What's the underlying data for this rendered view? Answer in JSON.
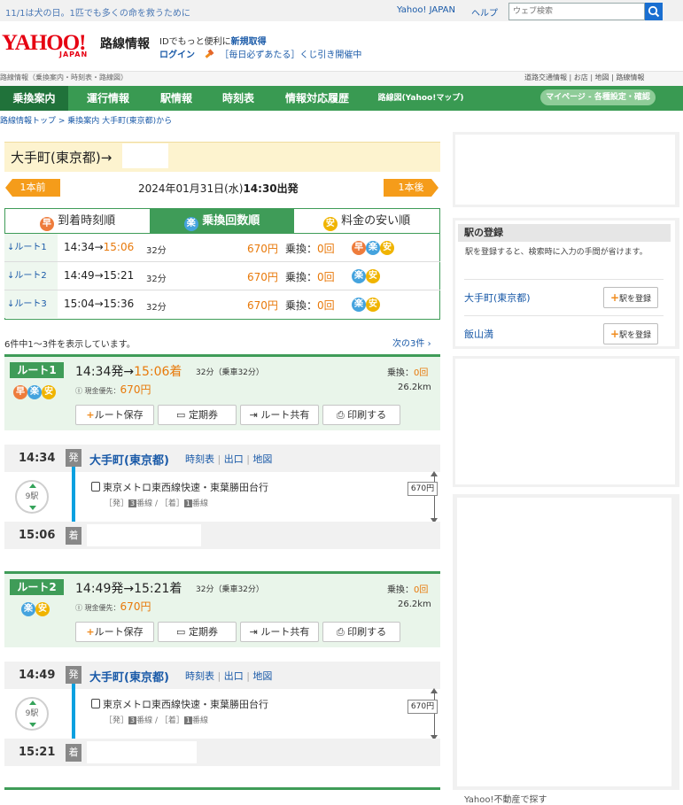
{
  "topbar": {
    "notice": "11/1は犬の日。1匹でも多くの命を救うために",
    "yahoo_japan": "Yahoo! JAPAN",
    "help": "ヘルプ",
    "search_placeholder": "ウェブ検索"
  },
  "header": {
    "logo_text": "YAHOO!",
    "logo_sub": "JAPAN",
    "service_name": "路線情報",
    "id_promo_prefix": "IDでもっと便利に",
    "id_promo_link": "新規取得",
    "login": "ログイン",
    "lottery": "［毎日必ずあたる］くじ引き開催中",
    "subtitle": "路線情報（乗換案内・時刻表・路線図）",
    "sublinks": "道路交通情報 | お店 | 地図 | 路線情報"
  },
  "nav": {
    "items": [
      "乗換案内",
      "運行情報",
      "駅情報",
      "時刻表",
      "情報対応履歴",
      "路線図(Yahoo!マップ)"
    ],
    "mypage": "マイページ - 各種設定・確認"
  },
  "breadcrumb": "路線情報トップ > 乗換案内 大手町(東京都)から",
  "search": {
    "title": "大手町(東京都)→",
    "prev": "1本前",
    "next": "1本後",
    "date": "2024年01月31日(水)",
    "time": "14:30出発"
  },
  "tabs": [
    {
      "icon": "早",
      "label": "到着時刻順"
    },
    {
      "icon": "楽",
      "label": "乗換回数順"
    },
    {
      "icon": "安",
      "label": "料金の安い順"
    }
  ],
  "summary": [
    {
      "label": "↓ルート1",
      "dep": "14:34→",
      "arr": "15:06",
      "dur": "32分",
      "fare": "670円",
      "xfer_label": "乗換：",
      "xfer": "0回"
    },
    {
      "label": "↓ルート2",
      "dep": "14:49→",
      "arr": "15:21",
      "dur": "32分",
      "fare": "670円",
      "xfer_label": "乗換：",
      "xfer": "0回"
    },
    {
      "label": "↓ルート3",
      "dep": "15:04→",
      "arr": "15:36",
      "dur": "32分",
      "fare": "670円",
      "xfer_label": "乗換：",
      "xfer": "0回"
    }
  ],
  "showing": "6件中1〜3件を表示しています。",
  "next3": "次の3件",
  "routes": [
    {
      "label": "ルート1",
      "dep": "14:34発→",
      "arr": "15:06着",
      "dur": "32分（乗車32分）",
      "fare_label": "現金優先：",
      "fare": "670円",
      "xfer_label": "乗換：",
      "xfer": "0回",
      "dist": "26.2km",
      "btn_save": "ルート保存",
      "btn_pass": "定期券",
      "btn_share": "ルート共有",
      "btn_print": "印刷する",
      "dep_time": "14:34",
      "dep_badge": "発",
      "station": "大手町(東京都)",
      "link_timetable": "時刻表",
      "link_exit": "出口",
      "link_map": "地図",
      "stops": "9駅",
      "train": "東京メトロ東西線快速・東葉勝田台行",
      "plat_dep": "［発］",
      "plat_dep_no": "3",
      "plat_arr": "［着］",
      "plat_arr_no": "1",
      "plat_unit": "番線",
      "leg_fare": "670円",
      "arr_time": "15:06",
      "arr_badge": "着"
    },
    {
      "label": "ルート2",
      "dep": "14:49発→",
      "arr": "15:21着",
      "dur": "32分（乗車32分）",
      "fare_label": "現金優先：",
      "fare": "670円",
      "xfer_label": "乗換：",
      "xfer": "0回",
      "dist": "26.2km",
      "btn_save": "ルート保存",
      "btn_pass": "定期券",
      "btn_share": "ルート共有",
      "btn_print": "印刷する",
      "dep_time": "14:49",
      "dep_badge": "発",
      "station": "大手町(東京都)",
      "link_timetable": "時刻表",
      "link_exit": "出口",
      "link_map": "地図",
      "stops": "9駅",
      "train": "東京メトロ東西線快速・東葉勝田台行",
      "plat_dep": "［発］",
      "plat_dep_no": "3",
      "plat_arr": "［着］",
      "plat_arr_no": "1",
      "plat_unit": "番線",
      "leg_fare": "670円",
      "arr_time": "15:21",
      "arr_badge": "着"
    }
  ],
  "sidebar": {
    "station_reg_title": "駅の登録",
    "station_reg_desc": "駅を登録すると、検索時に入力の手間が省けます。",
    "stations": [
      "大手町(東京都)",
      "飯山満"
    ],
    "register_btn": "駅を登録",
    "realestate": "Yahoo!不動産で探す"
  },
  "colors": {
    "brand_green": "#399a52",
    "accent_orange": "#e8790a",
    "yahoo_red": "#e60012"
  }
}
